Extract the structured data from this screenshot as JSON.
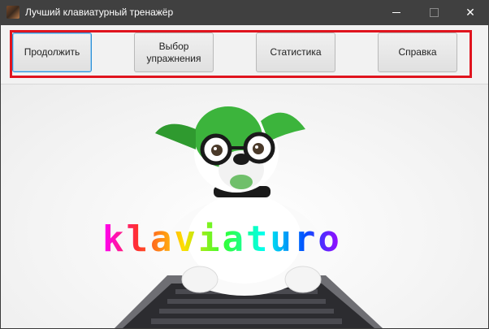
{
  "window": {
    "title": "Лучший клавиатурный тренажёр",
    "controls": [
      "minimize-icon",
      "maximize-icon",
      "close-icon"
    ]
  },
  "toolbar": {
    "buttons": [
      {
        "label": "Продолжить",
        "focused": true
      },
      {
        "label": "Выбор\nупражнения",
        "focused": false
      },
      {
        "label": "Статистика",
        "focused": false
      },
      {
        "label": "Справка",
        "focused": false
      }
    ],
    "highlight_color": "#e0141e"
  },
  "illustration": {
    "logo_text": "klaviaturo",
    "description_icon": "dog-with-glasses-at-keyboard"
  },
  "colors": {
    "titlebar": "#404040",
    "focus_border": "#2d8fd6",
    "dog_green": "#3cb43c"
  }
}
